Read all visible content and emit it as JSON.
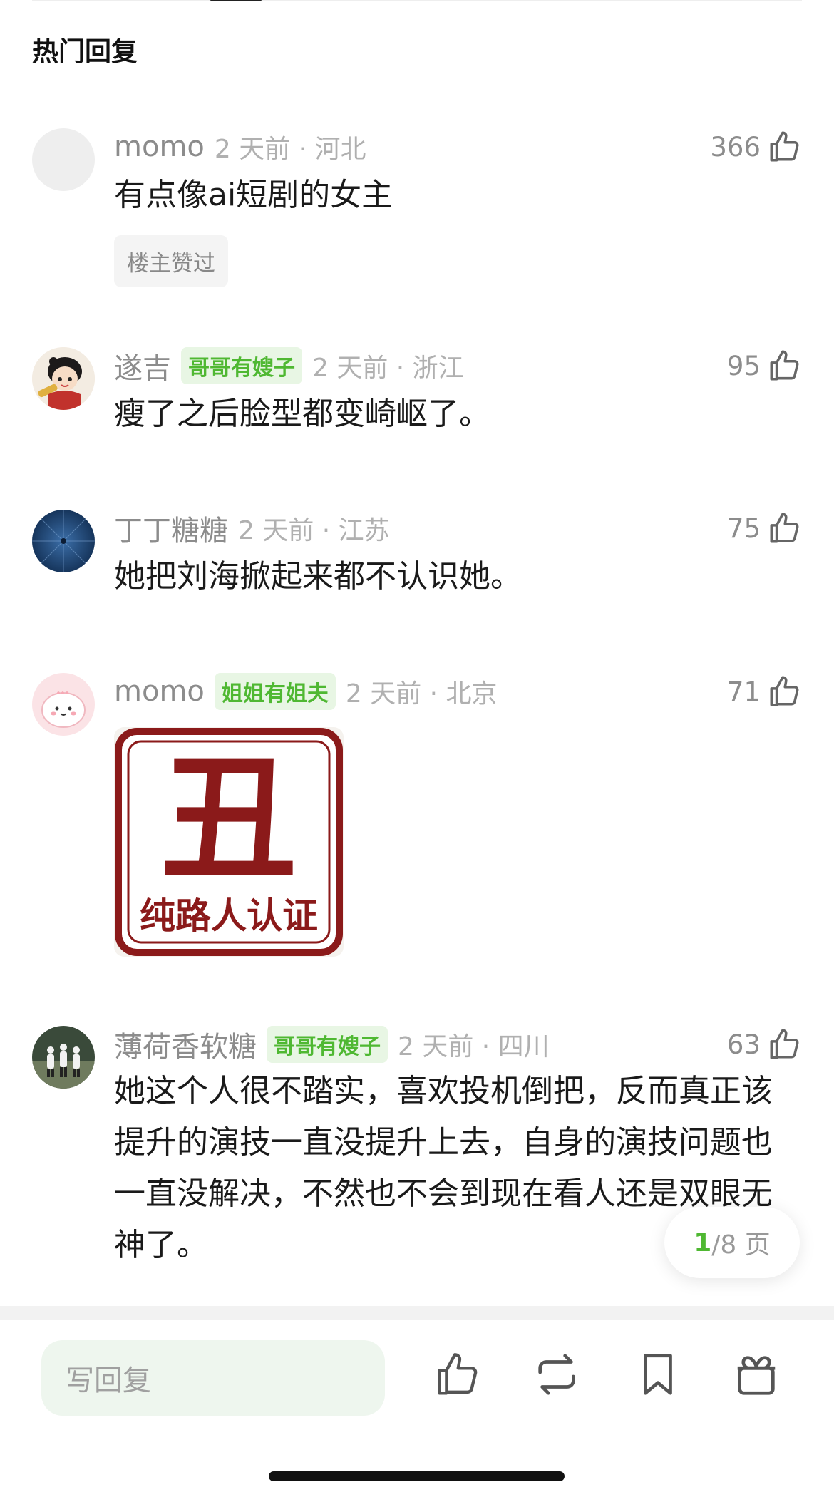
{
  "section_title": "热门回复",
  "comments": [
    {
      "username": "momo",
      "badge": "",
      "time": "2 天前 · 河北",
      "likes": "366",
      "text": "有点像ai短剧的女主",
      "op_liked": "楼主赞过"
    },
    {
      "username": "遂吉",
      "badge": "哥哥有嫂子",
      "time": "2 天前 · 浙江",
      "likes": "95",
      "text": "瘦了之后脸型都变崎岖了。"
    },
    {
      "username": "丁丁糖糖",
      "badge": "",
      "time": "2 天前 · 江苏",
      "likes": "75",
      "text": "她把刘海掀起来都不认识她。"
    },
    {
      "username": "momo",
      "badge": "姐姐有姐夫",
      "time": "2 天前 · 北京",
      "likes": "71",
      "sticker": {
        "big": "丑",
        "caption": "纯路人认证"
      }
    },
    {
      "username": "薄荷香软糖",
      "badge": "哥哥有嫂子",
      "time": "2 天前 · 四川",
      "likes": "63",
      "text": "她这个人很不踏实，喜欢投机倒把，反而真正该提升的演技一直没提升上去，自身的演技问题也一直没解决，不然也不会到现在看人还是双眼无神了。"
    }
  ],
  "pager": {
    "current": "1",
    "total": "/8 页"
  },
  "bottom_bar": {
    "reply_placeholder": "写回复"
  },
  "colors": {
    "accent_green": "#4fb832",
    "badge_bg": "#e8f6e4",
    "sticker_red": "#8b1a1a"
  },
  "icons": [
    "thumbs-up-icon",
    "repost-icon",
    "bookmark-icon",
    "gift-icon"
  ]
}
